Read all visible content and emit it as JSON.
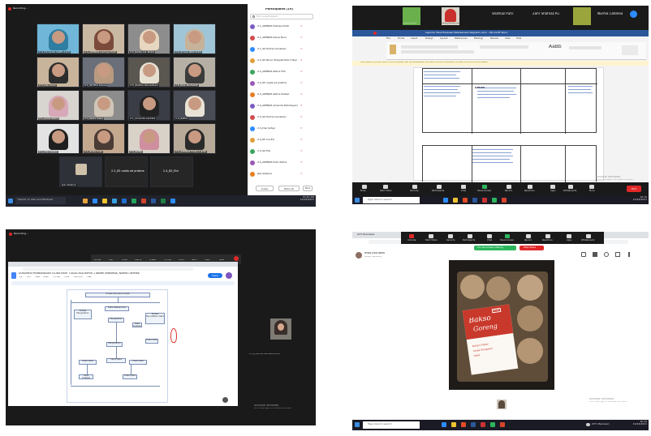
{
  "panel1": {
    "recording_label": "Recording...",
    "participants_title": "Participants (19)",
    "search_placeholder": "Find a participant",
    "tiles": [
      "2.4_Fernanda Deffa A.Z.P",
      "2.4_APPNUR Lainnya Putri",
      "2.5_Rezky Lia Tantia",
      "2.5_Arnisa Wadi Putri",
      "2.5_Dwi Cerio",
      "2.1_S0 Fikri Dwina",
      "2.5_Shafira Ramadhani",
      "2.6_Nisa Nurfaizah",
      "2.1_Anisa Zahra",
      "2.4_Nada Salsa",
      "2.1_Amanda Lazinha",
      "2.4_Safira",
      "2.1_Dwi Lestari",
      "2.2_Rizka Putri",
      "2.3_Shitta",
      "2.4_APPNUR Friska Luthfi",
      "Jesi Alawiya",
      "2.2_65 nadia ed pratma",
      "2.4_65_Elvi"
    ],
    "participants": [
      "2.1_APPNUR Febriani Putri",
      "2.1_APPNUR Kania Nuur",
      "2.1_S0 Dwina Gunawan",
      "2.2_65 Nurul Hidayati Putri Hasri",
      "2.2_APPNUR Zahra Fitri",
      "2.2_65 nadia ed pratma",
      "2.3_APPNUR Zahra Pertiwi",
      "2.4_APPNUR Amanda Rahmayani",
      "2.4_S0 Dwina Gunawan",
      "2.4_Dwi Cahyo",
      "2.4_65 Ina Evi",
      "2.4_S0 Elvi",
      "2.5_APPNUR Putri Zahra",
      "Jesi Alawiya"
    ],
    "invite_label": "Invite",
    "mute_all_label": "Mute All",
    "more_label": "More",
    "search_taskbar": "Search on web and Windows",
    "clock_time": "10:10 AM",
    "clock_date": "10/16/2021"
  },
  "panel2": {
    "top_users": [
      "CLASS MASLS",
      "Rizky Julia Nurmala",
      "Shafnaz Putri",
      "Zahr Shafnaz Pu",
      "Nurma Cahmea"
    ],
    "doc_title": "Laporan Hasil Evaluasi Pelaksanaan Kegiatan.docx - Microsoft Word",
    "menu_items": [
      "File",
      "Home",
      "Insert",
      "Design",
      "Layout",
      "References",
      "Mailings",
      "Review",
      "View",
      "Help"
    ],
    "style_sample": "AaBb",
    "notice_text": "Information you Microsoft Office Licensed will be unavailable Microsoft Office to activate Microsoft Office is not activated",
    "cell_label": "SAUSE",
    "toolbar_labels": [
      "Mute",
      "Start Video",
      "Security",
      "Participants",
      "Chat",
      "Share Screen",
      "Record",
      "Reactions",
      "Apps",
      "Whiteboards",
      "More"
    ],
    "end_label": "End",
    "activate_title": "Activate Windows",
    "activate_sub": "Go to Settings to activate Windows.",
    "search_taskbar": "Type here to search",
    "clock_time": "10:10",
    "clock_date": "10/16/2021"
  },
  "panel3": {
    "recording_label": "Recording...",
    "share_banner": "You are viewing Nurmal's screen",
    "doc_title": "DOKUMEN PEMBAHASAN FLOWCHART TUGAS KELOMPOK 2 dalam Indonesia, Nurma Cahmea",
    "menu_items": [
      "File",
      "Edit",
      "View",
      "Insert",
      "Format",
      "Tools",
      "Add-ons",
      "Help"
    ],
    "share_button": "Share",
    "flow_title": "Proses Pencarian Data",
    "flow_boxes": [
      "Proses Pengolahan",
      "Data Wawancara",
      "Pengolahan",
      "Data Analisis",
      "Proses Pencatatan Data",
      "Hasil Data",
      "Pengolahan",
      "Input Data",
      "Hasil Data",
      "Hasil Data",
      "Hasil Analisis",
      "Hasil Data"
    ],
    "annotate_labels": [
      "Mouse",
      "Text",
      "Draw",
      "Stamp",
      "Eraser",
      "Format",
      "Undo",
      "Redo",
      "Clear",
      "Save"
    ],
    "side_user": "2.1_0_Nurma Cahmea Anindi",
    "activate_title": "Activate Windows",
    "activate_sub": "Go to Settings to activate Windows."
  },
  "panel4": {
    "tab_label": "GCT Pancakes",
    "poster_name": "Risky Julia Bakti",
    "poster_sub": "Sudah diposting",
    "banner_text": "You are screen sharing",
    "stop_share": "Stop Share",
    "product_line1": "Bakso",
    "product_line2": "Goreng",
    "product_badge": "Enak",
    "product_items": [
      "Bahan Pilihan",
      "Tanpa Pengawet",
      "Halal"
    ],
    "toolbar_labels": [
      "Unmute",
      "Start Video",
      "Security",
      "Participants",
      "Chat",
      "Share Screen",
      "Record",
      "Reactions",
      "Apps",
      "Whiteboards"
    ],
    "activate_title": "Activate Windows",
    "activate_sub": "Go to Settings to activate Windows.",
    "search_taskbar": "Type here to search",
    "weather": "29°C Berawan",
    "clock_time": "10:10",
    "clock_date": "10/16/2021"
  },
  "colors": {
    "zoom_dark": "#1a1a1a",
    "zoom_grid": "#232323",
    "word_blue": "#2b579a",
    "zoom_red": "#e02828",
    "green_share": "#2db55d",
    "product_red": "#c8392b"
  }
}
